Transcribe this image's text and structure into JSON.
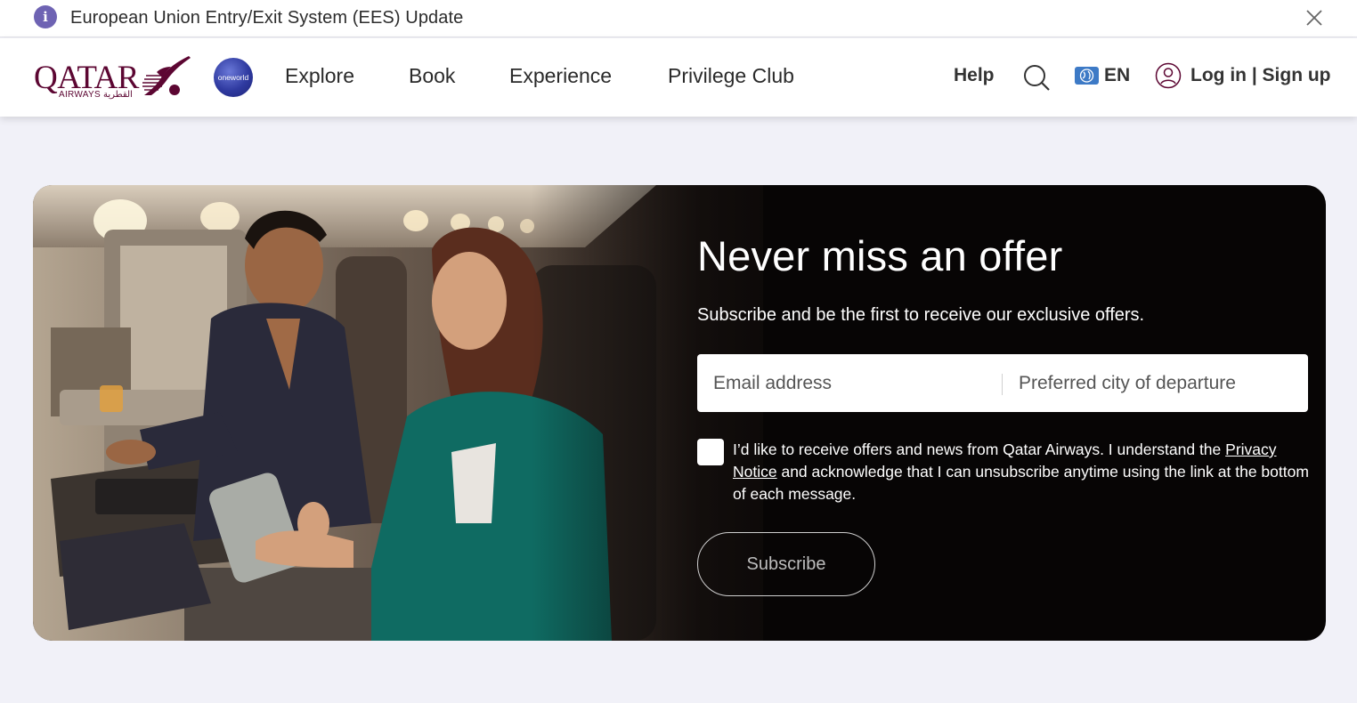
{
  "notice": {
    "text": "European Union Entry/Exit System (EES) Update"
  },
  "header": {
    "logo": {
      "word": "QATAR",
      "sub": "AIRWAYS القطرية"
    },
    "oneworld_label": "oneworld",
    "nav": [
      "Explore",
      "Book",
      "Experience",
      "Privilege Club"
    ],
    "help_label": "Help",
    "language_label": "EN",
    "login_label": "Log in | Sign up"
  },
  "banner": {
    "headline": "Never miss an offer",
    "subline": "Subscribe and be the first to receive our exclusive offers.",
    "email_placeholder": "Email address",
    "city_placeholder": "Preferred city of departure",
    "consent_before": "I’d like to receive offers and news from Qatar Airways. I understand the ",
    "consent_link": "Privacy Notice",
    "consent_after": " and acknowledge that I can unsubscribe anytime using the link at the bottom of each message.",
    "subscribe_label": "Subscribe"
  },
  "colors": {
    "brand": "#5c0632",
    "accent": "#6e63b3",
    "page_bg": "#f1f1f8",
    "banner_bg": "#070505"
  }
}
